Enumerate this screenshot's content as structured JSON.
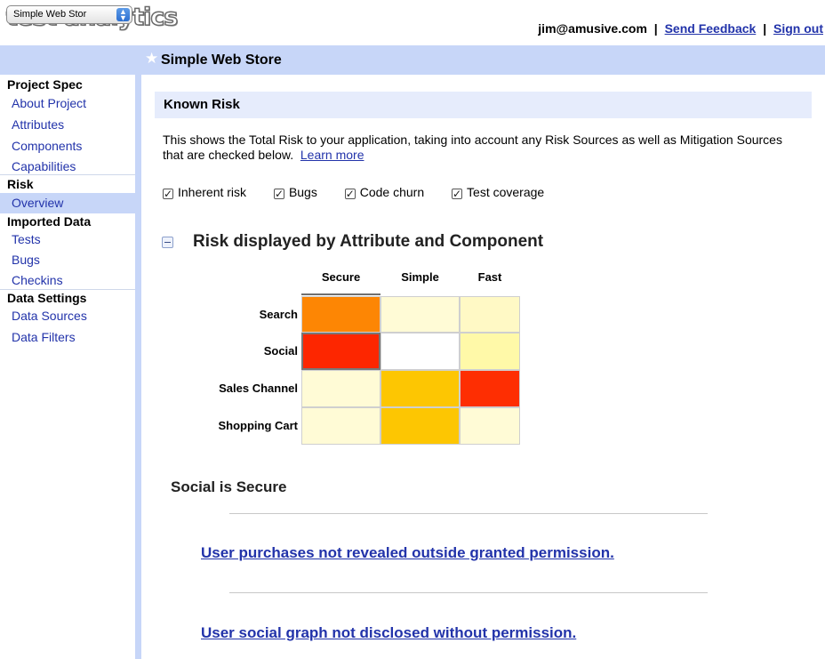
{
  "app": {
    "logo": "test analytics"
  },
  "user": {
    "email": "jim@amusive.com",
    "feedback": "Send Feedback",
    "signout": "Sign out",
    "separator": "|"
  },
  "project": {
    "selector_value": "Simple Web Stor",
    "title": "Simple Web Store"
  },
  "sidebar": {
    "sections": [
      {
        "heading": "Project Spec",
        "items": [
          "About Project",
          "Attributes",
          "Components",
          "Capabilities"
        ]
      },
      {
        "heading": "Risk",
        "items": [
          "Overview"
        ]
      },
      {
        "heading": "Imported Data",
        "items": [
          "Tests",
          "Bugs",
          "Checkins"
        ]
      },
      {
        "heading": "Data Settings",
        "items": [
          "Data Sources",
          "Data Filters"
        ]
      }
    ],
    "active_item": "Overview"
  },
  "known_risk": {
    "title": "Known Risk",
    "description": "This shows the Total Risk to your application, taking into account any Risk Sources as well as Mitigation Sources that are checked below.",
    "learn_more": "Learn more"
  },
  "filters": [
    {
      "label": "Inherent risk",
      "checked": true
    },
    {
      "label": "Bugs",
      "checked": true
    },
    {
      "label": "Code churn",
      "checked": true
    },
    {
      "label": "Test coverage",
      "checked": true
    }
  ],
  "heatmap": {
    "title": "Risk displayed by Attribute and Component",
    "attributes": [
      "Secure",
      "Simple",
      "Fast"
    ],
    "components": [
      "Search",
      "Social",
      "Sales Channel",
      "Shopping Cart"
    ],
    "cells": [
      [
        "#fd8604",
        "#fffbd6",
        "#fff9c5"
      ],
      [
        "#fd2600",
        "#ffffff",
        "#fff9a8"
      ],
      [
        "#fffbd6",
        "#fdc602",
        "#fe2e02"
      ],
      [
        "#fffbd6",
        "#fdc602",
        "#fffbd6"
      ]
    ],
    "selected": {
      "component": "Social",
      "attribute": "Secure"
    }
  },
  "detail": {
    "title": "Social is Secure",
    "capabilities": [
      "User purchases not revealed outside granted permission.",
      "User social graph not disclosed without permission."
    ]
  },
  "colors": {
    "accent_bar": "#c7d6f8",
    "panel": "#e6ecfc",
    "link": "#2233aa"
  }
}
